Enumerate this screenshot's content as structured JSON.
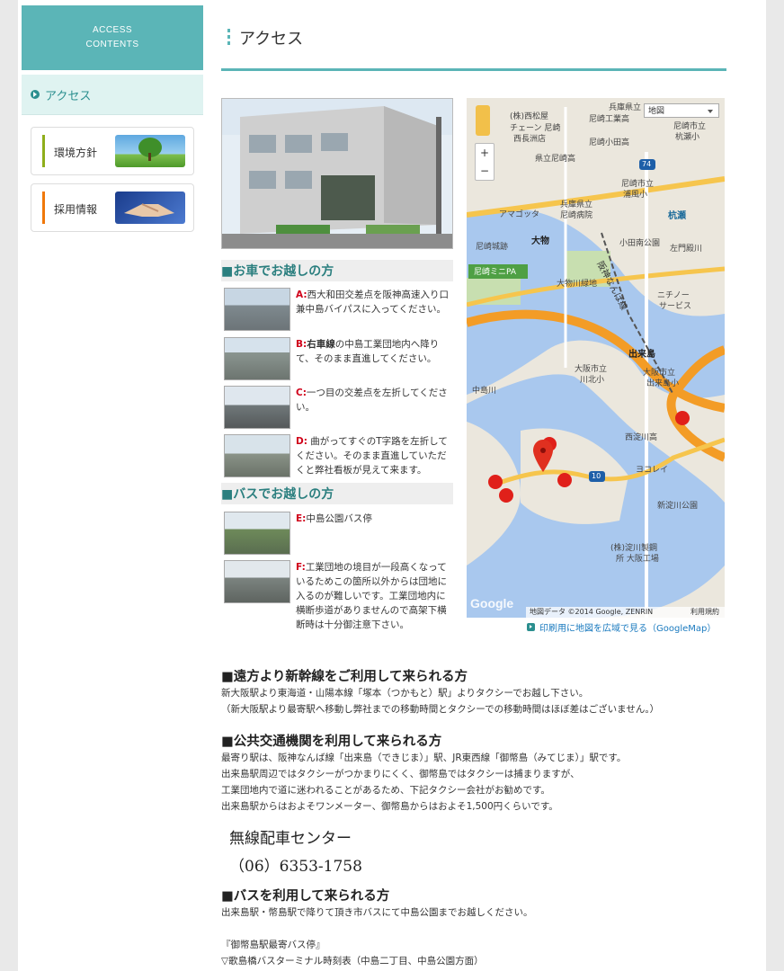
{
  "sidebar": {
    "header_line1": "ACCESS",
    "header_line2": "CONTENTS",
    "active_item": "アクセス",
    "cards": [
      {
        "label": "環境方針",
        "bar_color": "#8fae1b"
      },
      {
        "label": "採用情報",
        "bar_color": "#f0780a"
      }
    ]
  },
  "page": {
    "title": "アクセス"
  },
  "car": {
    "heading": "■お車でお越しの方",
    "steps": [
      {
        "key": "A:",
        "text": "西大和田交差点を阪神高速入り口兼中島バイパスに入ってください。"
      },
      {
        "key": "B:",
        "bold": "右車線",
        "text": "の中島工業団地内へ降りて、そのまま直進してください。"
      },
      {
        "key": "C:",
        "text": "一つ目の交差点を左折してください。"
      },
      {
        "key": "D:",
        "text": " 曲がってすぐのT字路を左折してください。そのまま直進していただくと弊社看板が見えて来ます。"
      }
    ]
  },
  "bus": {
    "heading": "■バスでお越しの方",
    "steps": [
      {
        "key": "E:",
        "text": "中島公園バス停"
      },
      {
        "key": "F:",
        "text": "工業団地の境目が一段高くなっているためこの箇所以外からは団地に入るのが難しいです。工業団地内に横断歩道がありませんので高架下横断時は十分御注意下さい。"
      }
    ]
  },
  "map": {
    "type_label": "地図",
    "zoom_in": "+",
    "zoom_out": "−",
    "attribution": "地図データ ©2014 Google, ZENRIN",
    "terms": "利用規約",
    "google": "Google",
    "labels": [
      "兵庫県立",
      "(株)西松屋",
      "尼崎工業高",
      "チェーン 尼崎",
      "西長洲店",
      "尼崎小田高",
      "県立尼崎高",
      "尼崎市立",
      "杭瀬小",
      "兵庫県立",
      "尼崎病院",
      "尼崎市立",
      "浦風小",
      "アマゴッタ",
      "杭瀬",
      "大物",
      "小田南公園",
      "左門殿川",
      "尼崎城跡",
      "尼崎ミニPA",
      "大物川緑地",
      "ニチノー",
      "サービス",
      "出来島",
      "大阪市立",
      "川北小",
      "大阪市立",
      "出来島小",
      "中島川",
      "西淀川高",
      "ヨコレイ",
      "新淀川公園",
      "(株)淀川製鋼",
      "所 大阪工場",
      "阪神なんば線",
      "74",
      "10"
    ],
    "link_text": "印刷用に地図を広域で見る（GoogleMap）"
  },
  "sections": [
    {
      "heading": "■遠方より新幹線をご利用して来られる方",
      "lines": [
        "新大阪駅より東海道・山陽本線「塚本（つかもと）駅」よりタクシーでお越し下さい。",
        "（新大阪駅より最寄駅へ移動し弊社までの移動時間とタクシーでの移動時間はほぼ差はございません。）"
      ]
    },
    {
      "heading": "■公共交通機関を利用して来られる方",
      "lines": [
        "最寄り駅は、阪神なんば線「出来島（できじま）」駅、JR東西線「御幣島（みてじま）」駅です。",
        "出来島駅周辺ではタクシーがつかまりにくく、御幣島ではタクシーは捕まりますが、",
        "工業団地内で道に迷われることがあるため、下記タクシー会社がお勧めです。",
        "出来島駅からはおよそワンメーター、御幣島からはおよそ1,500円くらいです。"
      ]
    }
  ],
  "taxi": {
    "name": "無線配車センター",
    "phone": "（06）6353-1758"
  },
  "bus_section": {
    "heading": "■バスを利用して来られる方",
    "line": "出来島駅・幣島駅で降りて頂き市バスにて中島公園までお越しください。",
    "sub1": "『御幣島駅最寄バス停』",
    "sub2": "▽歌島橋バスターミナル時刻表（中島二丁目、中島公園方面）"
  }
}
